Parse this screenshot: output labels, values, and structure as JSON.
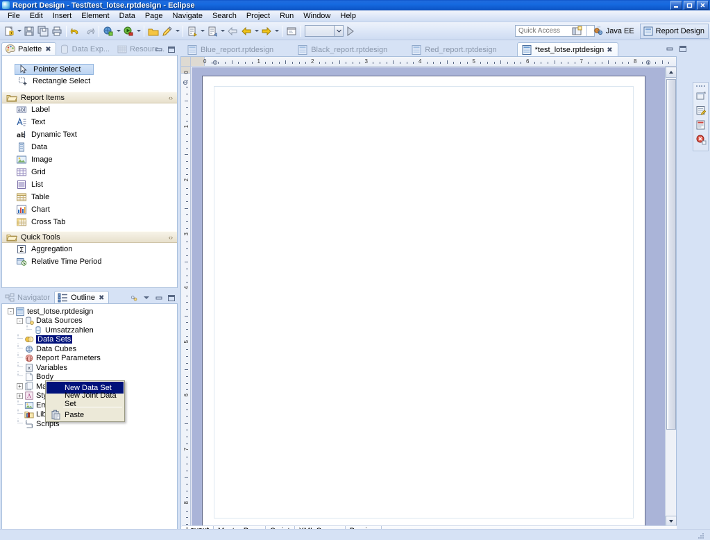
{
  "window": {
    "title": "Report Design - Test/test_lotse.rptdesign - Eclipse",
    "app_icon": "eclipse-icon",
    "minimize_label": "_",
    "restore_label": "❐",
    "close_label": "✕"
  },
  "menubar": {
    "items": [
      {
        "label": "File"
      },
      {
        "label": "Edit"
      },
      {
        "label": "Insert"
      },
      {
        "label": "Element"
      },
      {
        "label": "Data"
      },
      {
        "label": "Page"
      },
      {
        "label": "Navigate"
      },
      {
        "label": "Search"
      },
      {
        "label": "Project"
      },
      {
        "label": "Run"
      },
      {
        "label": "Window"
      },
      {
        "label": "Help"
      }
    ]
  },
  "toolbar": {
    "groups": [
      {
        "buttons": [
          {
            "icon": "new-wizard-icon",
            "dropdown": true
          },
          {
            "icon": "save-icon",
            "dropdown": false
          },
          {
            "icon": "save-all-icon",
            "dropdown": false
          },
          {
            "icon": "print-icon",
            "dropdown": false
          }
        ]
      },
      {
        "buttons": [
          {
            "icon": "undo-icon",
            "dropdown": false
          },
          {
            "icon": "redo-icon",
            "dropdown": false
          }
        ]
      },
      {
        "buttons": [
          {
            "icon": "debug-icon",
            "dropdown": true
          },
          {
            "icon": "run-icon",
            "dropdown": true
          }
        ]
      },
      {
        "buttons": [
          {
            "icon": "open-folder-icon",
            "dropdown": false
          },
          {
            "icon": "pencil-edit-icon",
            "dropdown": true
          }
        ]
      },
      {
        "buttons": [
          {
            "icon": "next-annotation-icon",
            "dropdown": true
          },
          {
            "icon": "previous-annotation-icon",
            "dropdown": true
          },
          {
            "icon": "back-arrow-icon",
            "dropdown": false
          },
          {
            "icon": "back-history-icon",
            "dropdown": true
          },
          {
            "icon": "forward-arrow-icon",
            "dropdown": true
          }
        ]
      },
      {
        "buttons": [
          {
            "icon": "preview-icon",
            "dropdown": false
          }
        ]
      }
    ],
    "combo_value": "",
    "combo_after_icon": "run-report-icon"
  },
  "quick_access": {
    "placeholder": "Quick Access"
  },
  "perspectives": {
    "open_perspective_icon": "open-perspective-icon",
    "items": [
      {
        "label": "Java EE",
        "icon": "java-ee-icon",
        "active": false
      },
      {
        "label": "Report Design",
        "icon": "report-design-icon",
        "active": true
      }
    ]
  },
  "palette_view": {
    "tabs": [
      {
        "label": "Palette",
        "icon": "palette-icon",
        "active": true,
        "closable": true
      },
      {
        "label": "Data Exp...",
        "icon": "data-explorer-icon",
        "active": false,
        "closable": false
      },
      {
        "label": "Resourc...",
        "icon": "resource-explorer-icon",
        "active": false,
        "closable": false
      }
    ],
    "close_glyph": "✖",
    "minimize_glyph": "–",
    "maximize_glyph": "□",
    "tools": [
      {
        "label": "Pointer Select",
        "icon": "pointer-select-icon",
        "selected": true
      },
      {
        "label": "Rectangle Select",
        "icon": "rectangle-select-icon",
        "selected": false
      }
    ],
    "groups": [
      {
        "label": "Report Items",
        "icon": "folder-open-icon",
        "collapse_glyph": "‹›",
        "items": [
          {
            "label": "Label",
            "icon": "label-icon"
          },
          {
            "label": "Text",
            "icon": "text-icon"
          },
          {
            "label": "Dynamic Text",
            "icon": "dynamic-text-icon"
          },
          {
            "label": "Data",
            "icon": "data-icon"
          },
          {
            "label": "Image",
            "icon": "image-icon"
          },
          {
            "label": "Grid",
            "icon": "grid-icon"
          },
          {
            "label": "List",
            "icon": "list-icon"
          },
          {
            "label": "Table",
            "icon": "table-icon"
          },
          {
            "label": "Chart",
            "icon": "chart-icon"
          },
          {
            "label": "Cross Tab",
            "icon": "cross-tab-icon"
          }
        ]
      },
      {
        "label": "Quick Tools",
        "icon": "folder-open-icon",
        "collapse_glyph": "‹›",
        "items": [
          {
            "label": "Aggregation",
            "icon": "aggregation-icon"
          },
          {
            "label": "Relative Time Period",
            "icon": "relative-time-period-icon"
          }
        ]
      }
    ]
  },
  "outline_view": {
    "tabs": [
      {
        "label": "Navigator",
        "icon": "navigator-icon",
        "active": false,
        "closable": false
      },
      {
        "label": "Outline",
        "icon": "outline-icon",
        "active": true,
        "closable": true
      }
    ],
    "close_glyph": "✖",
    "link_icon": "link-with-editor-icon",
    "menu_glyph": "▽",
    "minimize_glyph": "–",
    "maximize_glyph": "□",
    "tree": [
      {
        "label": "test_lotse.rptdesign",
        "icon": "report-file-icon",
        "depth": 0,
        "expander": "-",
        "selected": false
      },
      {
        "label": "Data Sources",
        "icon": "data-sources-icon",
        "depth": 1,
        "expander": "-",
        "selected": false
      },
      {
        "label": "Umsatzzahlen",
        "icon": "data-source-icon",
        "depth": 2,
        "expander": "",
        "selected": false
      },
      {
        "label": "Data Sets",
        "icon": "data-sets-icon",
        "depth": 1,
        "expander": "",
        "selected": true
      },
      {
        "label": "Data Cubes",
        "icon": "data-cubes-icon",
        "depth": 1,
        "expander": "",
        "selected": false
      },
      {
        "label": "Report Parameters",
        "icon": "report-parameters-icon",
        "depth": 1,
        "expander": "",
        "selected": false
      },
      {
        "label": "Variables",
        "icon": "variables-icon",
        "depth": 1,
        "expander": "",
        "selected": false
      },
      {
        "label": "Body",
        "icon": "body-icon",
        "depth": 1,
        "expander": "",
        "selected": false
      },
      {
        "label": "MasterPages",
        "icon": "master-pages-icon",
        "depth": 1,
        "expander": "+",
        "selected": false
      },
      {
        "label": "Styles",
        "icon": "styles-icon",
        "depth": 1,
        "expander": "+",
        "selected": false
      },
      {
        "label": "Embedded Images",
        "icon": "embedded-images-icon",
        "depth": 1,
        "expander": "",
        "selected": false
      },
      {
        "label": "Libraries",
        "icon": "libraries-icon",
        "depth": 1,
        "expander": "",
        "selected": false
      },
      {
        "label": "Scripts",
        "icon": "scripts-icon",
        "depth": 1,
        "expander": "",
        "selected": false
      }
    ]
  },
  "context_menu": {
    "items": [
      {
        "label": "New Data Set",
        "highlighted": true,
        "icon": ""
      },
      {
        "label": "New Joint Data Set",
        "highlighted": false,
        "icon": ""
      },
      {
        "separator": true
      },
      {
        "label": "Paste",
        "highlighted": false,
        "icon": "paste-icon"
      }
    ]
  },
  "editor": {
    "tabs": [
      {
        "label": "Blue_report.rptdesign",
        "icon": "report-file-icon",
        "active": false,
        "closable": false
      },
      {
        "label": "Black_report.rptdesign",
        "icon": "report-file-icon",
        "active": false,
        "closable": false
      },
      {
        "label": "Red_report.rptdesign",
        "icon": "report-file-icon",
        "active": false,
        "closable": false
      },
      {
        "label": "*test_lotse.rptdesign",
        "icon": "report-file-icon",
        "active": true,
        "closable": true
      }
    ],
    "close_glyph": "✖",
    "minimize_glyph": "–",
    "maximize_glyph": "□",
    "h_ruler_numbers": [
      "0",
      "1",
      "2",
      "3",
      "4",
      "5",
      "6",
      "7",
      "8"
    ],
    "v_ruler_numbers": [
      "0",
      "1",
      "2",
      "3",
      "4",
      "5",
      "6",
      "7",
      "8"
    ],
    "scroll_up_glyph": "▲",
    "scroll_down_glyph": "▼",
    "bottom_tabs": [
      {
        "label": "Layout",
        "active": true
      },
      {
        "label": "Master Page",
        "active": false
      },
      {
        "label": "Script",
        "active": false
      },
      {
        "label": "XML Source",
        "active": false
      },
      {
        "label": "Preview",
        "active": false
      }
    ]
  },
  "fast_view": {
    "buttons": [
      {
        "icon": "restore-view-icon"
      },
      {
        "icon": "property-editor-icon"
      },
      {
        "icon": "report-preview-icon"
      },
      {
        "icon": "error-log-icon"
      }
    ]
  },
  "colors": {
    "title_blue": "#0d56c8",
    "selection_navy": "#00117a",
    "canvas_bg": "#aab4d8",
    "panel_bg": "#d6e2f5",
    "group_header": "#e8e0cc"
  }
}
